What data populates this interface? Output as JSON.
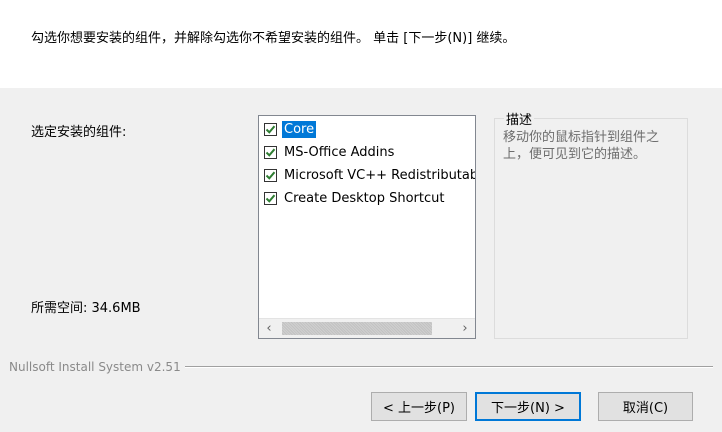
{
  "header": {
    "instruction": "勾选你想要安装的组件，并解除勾选你不希望安装的组件。 单击 [下一步(N)] 继续。"
  },
  "labels": {
    "select_components": "选定安装的组件:",
    "space_required": "所需空间: 34.6MB"
  },
  "components": [
    {
      "label": "Core",
      "checked": true,
      "selected": true
    },
    {
      "label": "MS-Office Addins",
      "checked": true,
      "selected": false
    },
    {
      "label": "Microsoft VC++ Redistributable",
      "checked": true,
      "selected": false
    },
    {
      "label": "Create Desktop Shortcut",
      "checked": true,
      "selected": false
    }
  ],
  "description": {
    "title": "描述",
    "text": "移动你的鼠标指针到组件之上，便可见到它的描述。"
  },
  "branding": "Nullsoft Install System v2.51",
  "buttons": {
    "back": "< 上一步(P)",
    "next": "下一步(N) >",
    "cancel": "取消(C)"
  },
  "colors": {
    "background": "#f0f0f0",
    "selection": "#0078d7",
    "checkmark": "#2e7d32"
  }
}
